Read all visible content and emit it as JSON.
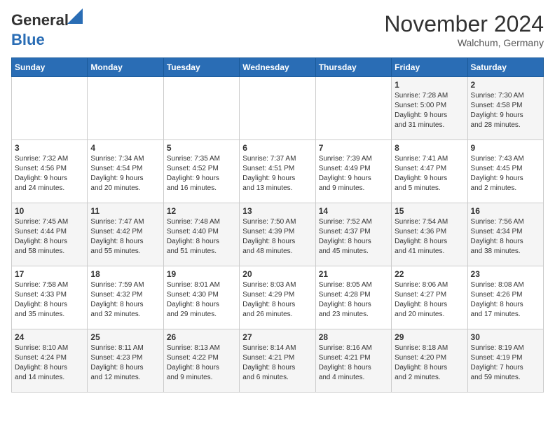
{
  "header": {
    "logo_general": "General",
    "logo_blue": "Blue",
    "month_title": "November 2024",
    "location": "Walchum, Germany"
  },
  "weekdays": [
    "Sunday",
    "Monday",
    "Tuesday",
    "Wednesday",
    "Thursday",
    "Friday",
    "Saturday"
  ],
  "weeks": [
    [
      {
        "day": "",
        "info": ""
      },
      {
        "day": "",
        "info": ""
      },
      {
        "day": "",
        "info": ""
      },
      {
        "day": "",
        "info": ""
      },
      {
        "day": "",
        "info": ""
      },
      {
        "day": "1",
        "info": "Sunrise: 7:28 AM\nSunset: 5:00 PM\nDaylight: 9 hours\nand 31 minutes."
      },
      {
        "day": "2",
        "info": "Sunrise: 7:30 AM\nSunset: 4:58 PM\nDaylight: 9 hours\nand 28 minutes."
      }
    ],
    [
      {
        "day": "3",
        "info": "Sunrise: 7:32 AM\nSunset: 4:56 PM\nDaylight: 9 hours\nand 24 minutes."
      },
      {
        "day": "4",
        "info": "Sunrise: 7:34 AM\nSunset: 4:54 PM\nDaylight: 9 hours\nand 20 minutes."
      },
      {
        "day": "5",
        "info": "Sunrise: 7:35 AM\nSunset: 4:52 PM\nDaylight: 9 hours\nand 16 minutes."
      },
      {
        "day": "6",
        "info": "Sunrise: 7:37 AM\nSunset: 4:51 PM\nDaylight: 9 hours\nand 13 minutes."
      },
      {
        "day": "7",
        "info": "Sunrise: 7:39 AM\nSunset: 4:49 PM\nDaylight: 9 hours\nand 9 minutes."
      },
      {
        "day": "8",
        "info": "Sunrise: 7:41 AM\nSunset: 4:47 PM\nDaylight: 9 hours\nand 5 minutes."
      },
      {
        "day": "9",
        "info": "Sunrise: 7:43 AM\nSunset: 4:45 PM\nDaylight: 9 hours\nand 2 minutes."
      }
    ],
    [
      {
        "day": "10",
        "info": "Sunrise: 7:45 AM\nSunset: 4:44 PM\nDaylight: 8 hours\nand 58 minutes."
      },
      {
        "day": "11",
        "info": "Sunrise: 7:47 AM\nSunset: 4:42 PM\nDaylight: 8 hours\nand 55 minutes."
      },
      {
        "day": "12",
        "info": "Sunrise: 7:48 AM\nSunset: 4:40 PM\nDaylight: 8 hours\nand 51 minutes."
      },
      {
        "day": "13",
        "info": "Sunrise: 7:50 AM\nSunset: 4:39 PM\nDaylight: 8 hours\nand 48 minutes."
      },
      {
        "day": "14",
        "info": "Sunrise: 7:52 AM\nSunset: 4:37 PM\nDaylight: 8 hours\nand 45 minutes."
      },
      {
        "day": "15",
        "info": "Sunrise: 7:54 AM\nSunset: 4:36 PM\nDaylight: 8 hours\nand 41 minutes."
      },
      {
        "day": "16",
        "info": "Sunrise: 7:56 AM\nSunset: 4:34 PM\nDaylight: 8 hours\nand 38 minutes."
      }
    ],
    [
      {
        "day": "17",
        "info": "Sunrise: 7:58 AM\nSunset: 4:33 PM\nDaylight: 8 hours\nand 35 minutes."
      },
      {
        "day": "18",
        "info": "Sunrise: 7:59 AM\nSunset: 4:32 PM\nDaylight: 8 hours\nand 32 minutes."
      },
      {
        "day": "19",
        "info": "Sunrise: 8:01 AM\nSunset: 4:30 PM\nDaylight: 8 hours\nand 29 minutes."
      },
      {
        "day": "20",
        "info": "Sunrise: 8:03 AM\nSunset: 4:29 PM\nDaylight: 8 hours\nand 26 minutes."
      },
      {
        "day": "21",
        "info": "Sunrise: 8:05 AM\nSunset: 4:28 PM\nDaylight: 8 hours\nand 23 minutes."
      },
      {
        "day": "22",
        "info": "Sunrise: 8:06 AM\nSunset: 4:27 PM\nDaylight: 8 hours\nand 20 minutes."
      },
      {
        "day": "23",
        "info": "Sunrise: 8:08 AM\nSunset: 4:26 PM\nDaylight: 8 hours\nand 17 minutes."
      }
    ],
    [
      {
        "day": "24",
        "info": "Sunrise: 8:10 AM\nSunset: 4:24 PM\nDaylight: 8 hours\nand 14 minutes."
      },
      {
        "day": "25",
        "info": "Sunrise: 8:11 AM\nSunset: 4:23 PM\nDaylight: 8 hours\nand 12 minutes."
      },
      {
        "day": "26",
        "info": "Sunrise: 8:13 AM\nSunset: 4:22 PM\nDaylight: 8 hours\nand 9 minutes."
      },
      {
        "day": "27",
        "info": "Sunrise: 8:14 AM\nSunset: 4:21 PM\nDaylight: 8 hours\nand 6 minutes."
      },
      {
        "day": "28",
        "info": "Sunrise: 8:16 AM\nSunset: 4:21 PM\nDaylight: 8 hours\nand 4 minutes."
      },
      {
        "day": "29",
        "info": "Sunrise: 8:18 AM\nSunset: 4:20 PM\nDaylight: 8 hours\nand 2 minutes."
      },
      {
        "day": "30",
        "info": "Sunrise: 8:19 AM\nSunset: 4:19 PM\nDaylight: 7 hours\nand 59 minutes."
      }
    ]
  ]
}
